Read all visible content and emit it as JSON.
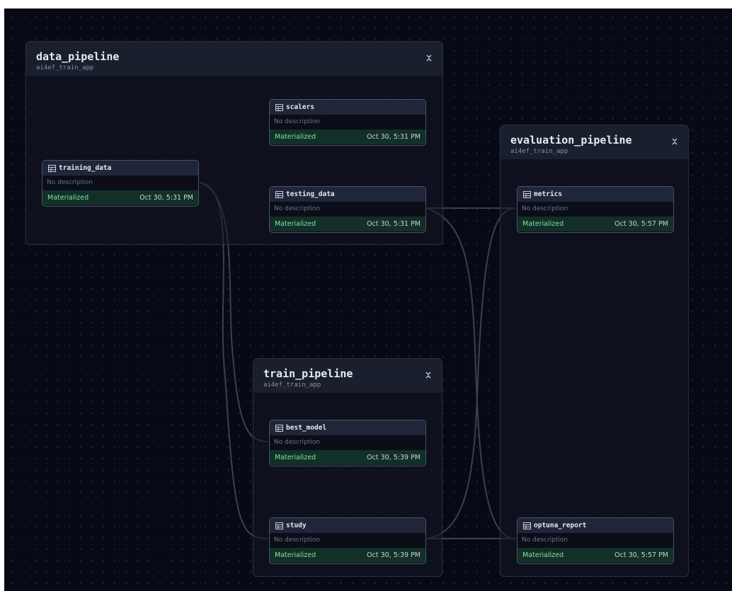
{
  "groups": {
    "data": {
      "title": "data_pipeline",
      "subtitle": "ai4ef_train_app"
    },
    "evaluation": {
      "title": "evaluation_pipeline",
      "subtitle": "ai4ef_train_app"
    },
    "train": {
      "title": "train_pipeline",
      "subtitle": "ai4ef_train_app"
    }
  },
  "assets": {
    "training_data": {
      "name": "training_data",
      "description": "No description",
      "status": "Materialized",
      "time": "Oct 30, 5:31 PM"
    },
    "scalers": {
      "name": "scalers",
      "description": "No description",
      "status": "Materialized",
      "time": "Oct 30, 5:31 PM"
    },
    "testing_data": {
      "name": "testing_data",
      "description": "No description",
      "status": "Materialized",
      "time": "Oct 30, 5:31 PM"
    },
    "metrics": {
      "name": "metrics",
      "description": "No description",
      "status": "Materialized",
      "time": "Oct 30, 5:57 PM"
    },
    "best_model": {
      "name": "best_model",
      "description": "No description",
      "status": "Materialized",
      "time": "Oct 30, 5:39 PM"
    },
    "study": {
      "name": "study",
      "description": "No description",
      "status": "Materialized",
      "time": "Oct 30, 5:39 PM"
    },
    "optuna_report": {
      "name": "optuna_report",
      "description": "No description",
      "status": "Materialized",
      "time": "Oct 30, 5:57 PM"
    }
  },
  "icons": {
    "asset": "table-icon",
    "group_toggle": "collapse-icon"
  },
  "colors": {
    "canvas_background": "#070a16",
    "edge": "#3a4052",
    "materialized": "#7ee3a3",
    "status_background": "#123028"
  }
}
